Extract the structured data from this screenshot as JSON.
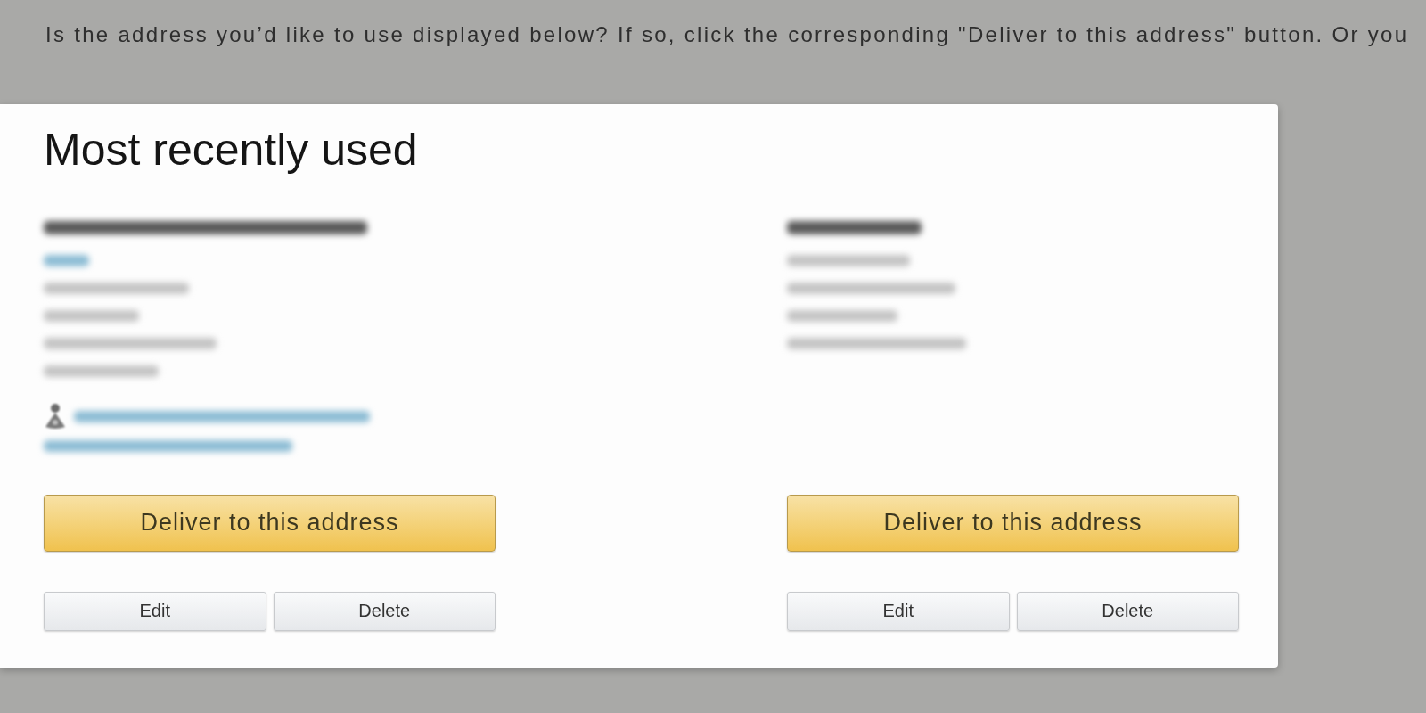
{
  "instructions": "Is the address you’d like to use displayed below? If so, click the corresponding \"Deliver to this address\" button. Or you",
  "panel": {
    "title": "Most recently used",
    "addresses": [
      {
        "lines": [
          {
            "kind": "name"
          },
          {
            "kind": "link"
          },
          {
            "kind": "plain"
          },
          {
            "kind": "plain"
          },
          {
            "kind": "plain"
          },
          {
            "kind": "plain"
          }
        ],
        "notice": {
          "lines": [
            {
              "kind": "link"
            },
            {
              "kind": "link"
            }
          ]
        },
        "primary_button": "Deliver to this address",
        "edit_button": "Edit",
        "delete_button": "Delete"
      },
      {
        "lines": [
          {
            "kind": "name"
          },
          {
            "kind": "plain"
          },
          {
            "kind": "plain"
          },
          {
            "kind": "plain"
          },
          {
            "kind": "plain"
          }
        ],
        "primary_button": "Deliver to this address",
        "edit_button": "Edit",
        "delete_button": "Delete"
      }
    ]
  }
}
